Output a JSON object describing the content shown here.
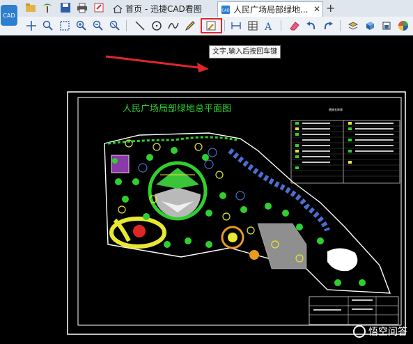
{
  "tabs": [
    {
      "label": "首页 - 迅捷CAD看图"
    },
    {
      "label": "人民广场局部绿地..."
    }
  ],
  "app_icon_text": "CAD",
  "tooltip": "文字,输入后按回车键",
  "drawing": {
    "title": "人民广场局部绿地总平面图",
    "legend_title": "植物名称表"
  },
  "watermark": "悟空问答",
  "colors": {
    "highlight": "#e0262b",
    "arrow": "#e0262b"
  }
}
